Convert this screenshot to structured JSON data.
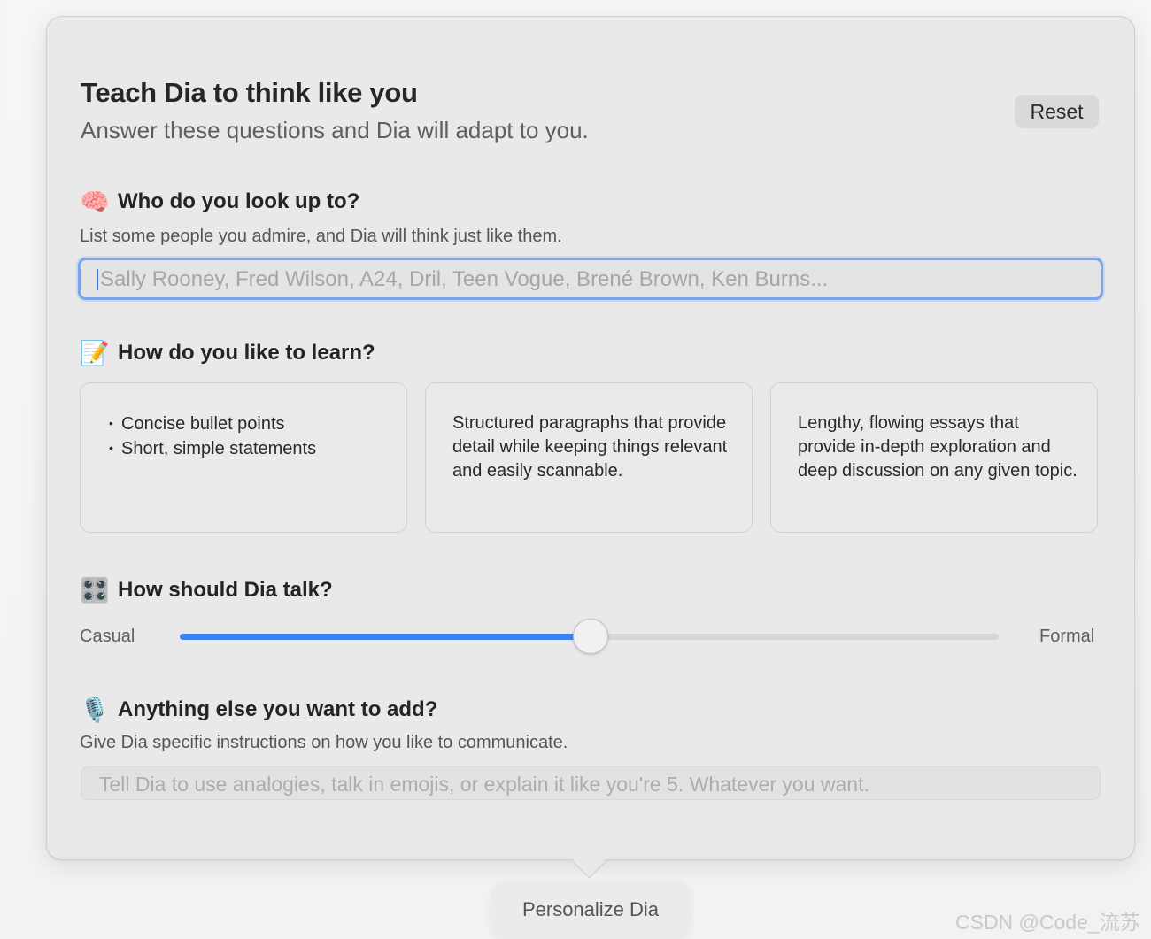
{
  "header": {
    "title": "Teach Dia to think like you",
    "subtitle": "Answer these questions and Dia will adapt to you.",
    "reset_label": "Reset"
  },
  "people": {
    "icon": "brain-icon",
    "emoji": "🧠",
    "heading": "Who do you look up to?",
    "description": "List some people you admire, and Dia will think just like them.",
    "input_value": "",
    "placeholder": "Sally Rooney, Fred Wilson, A24, Dril, Teen Vogue, Brené Brown, Ken Burns..."
  },
  "learning": {
    "icon": "memo-icon",
    "emoji": "📝",
    "heading": "How do you like to learn?",
    "options": [
      {
        "bullets": [
          "Concise bullet points",
          "Short, simple statements"
        ]
      },
      {
        "text": "Structured paragraphs that provide detail while keeping things relevant and easily scannable."
      },
      {
        "text": "Lengthy, flowing essays that provide in-depth exploration and deep discussion on any given topic."
      }
    ]
  },
  "tone": {
    "icon": "control-knobs-icon",
    "emoji": "🎛️",
    "heading": "How should Dia talk?",
    "min_label": "Casual",
    "max_label": "Formal",
    "value": 0.5,
    "accent_color": "#3b82f0"
  },
  "extra": {
    "icon": "microphone-icon",
    "emoji": "🎙️",
    "heading": "Anything else you want to add?",
    "description": "Give Dia specific instructions on how you like to communicate.",
    "input_value": "",
    "placeholder": "Tell Dia to use analogies, talk in emojis, or explain it like you're 5. Whatever you want."
  },
  "footer": {
    "personalize_label": "Personalize Dia"
  },
  "watermark": "CSDN @Code_流苏"
}
